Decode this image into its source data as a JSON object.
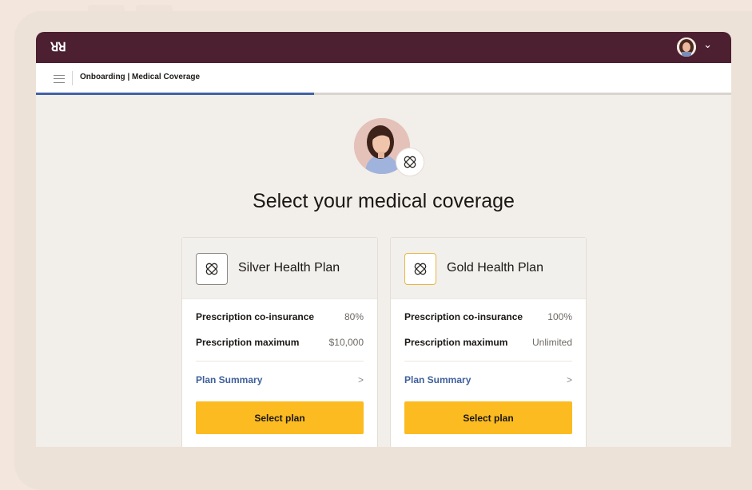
{
  "app": {
    "logo_text": "꽤",
    "breadcrumb": "Onboarding | Medical Coverage",
    "progress_fraction": 0.4
  },
  "page": {
    "title": "Select your medical coverage"
  },
  "plans": [
    {
      "name": "Silver Health Plan",
      "icon": "plan-bandage-icon",
      "icon_border_color": "#8d8883",
      "rows": [
        {
          "label": "Prescription co-insurance",
          "value": "80%"
        },
        {
          "label": "Prescription maximum",
          "value": "$10,000"
        }
      ],
      "summary_label": "Plan Summary",
      "summary_arrow": ">",
      "button_label": "Select plan"
    },
    {
      "name": "Gold Health Plan",
      "icon": "plan-bandage-icon",
      "icon_border_color": "#e7b743",
      "rows": [
        {
          "label": "Prescription co-insurance",
          "value": "100%"
        },
        {
          "label": "Prescription maximum",
          "value": "Unlimited"
        }
      ],
      "summary_label": "Plan Summary",
      "summary_arrow": ">",
      "button_label": "Select plan"
    }
  ],
  "colors": {
    "titlebar": "#4c1f31",
    "accent_progress": "#4161a8",
    "button": "#fbbb21",
    "link": "#3e5f9c"
  }
}
